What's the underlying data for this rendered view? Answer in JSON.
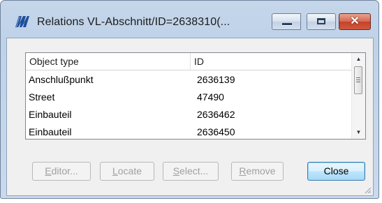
{
  "window": {
    "title": "Relations VL-Abschnitt/ID=2638310(...",
    "icon": "app-logo-icon",
    "caption_buttons": {
      "minimize_icon": "minimize-icon",
      "maximize_icon": "maximize-icon",
      "close_glyph": "✕"
    }
  },
  "list": {
    "columns": {
      "type": "Object type",
      "id": "ID"
    },
    "rows": [
      {
        "type": "Anschlußpunkt",
        "id": "2636139"
      },
      {
        "type": "Street",
        "id": "47490"
      },
      {
        "type": "Einbauteil",
        "id": "2636462"
      },
      {
        "type": "Einbauteil",
        "id": "2636450"
      }
    ]
  },
  "buttons": {
    "editor": {
      "prefix": "",
      "accel": "E",
      "rest": "ditor..."
    },
    "locate": {
      "prefix": "",
      "accel": "L",
      "rest": "ocate"
    },
    "select": {
      "prefix": "",
      "accel": "S",
      "rest": "elect..."
    },
    "remove": {
      "prefix": "",
      "accel": "R",
      "rest": "emove"
    },
    "close": "Close"
  },
  "colors": {
    "title_frame": "#bfd2e8",
    "close_button": "#c3442a",
    "default_button_border": "#3c7fb1"
  }
}
